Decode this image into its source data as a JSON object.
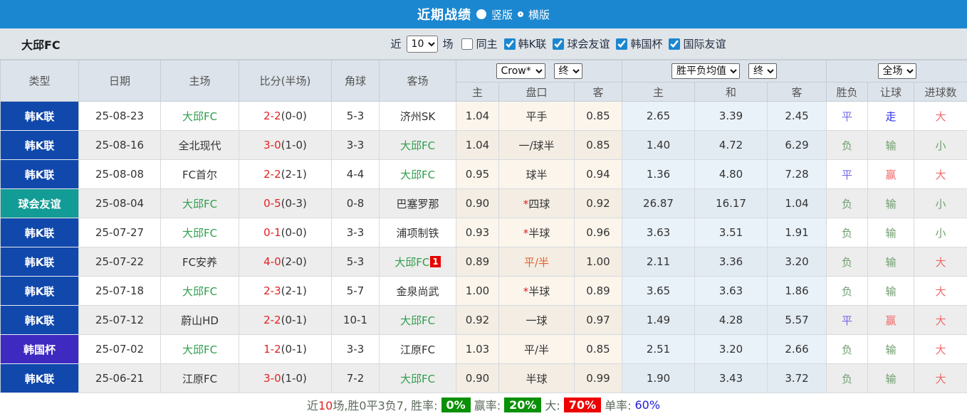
{
  "colors": {
    "topbar": "#1b87d0",
    "league_kleague": "#1148ab",
    "league_friendly": "#129c95",
    "league_cup": "#3e2ac0",
    "team_green": "#2f9e4c",
    "score_red": "#e32020",
    "badge_green": "#0a9006",
    "badge_red": "#ee0000"
  },
  "titlebar": {
    "title": "近期战绩",
    "layout_options": [
      {
        "label": "竖版",
        "selected": true
      },
      {
        "label": "横版",
        "selected": false
      }
    ]
  },
  "filterbar": {
    "team": "大邱FC",
    "near_label": "近",
    "count": "10",
    "games_label": "场",
    "same_home": {
      "label": "同主",
      "checked": false
    },
    "leagues": [
      {
        "label": "韩K联",
        "checked": true
      },
      {
        "label": "球会友谊",
        "checked": true
      },
      {
        "label": "韩国杯",
        "checked": true
      },
      {
        "label": "国际友谊",
        "checked": true
      }
    ]
  },
  "table": {
    "headers_left": [
      "类型",
      "日期",
      "主场",
      "比分(半场)",
      "角球",
      "客场"
    ],
    "dropdowns": {
      "company": "Crow*",
      "company_stage": "终",
      "market": "胜平负均值",
      "market_stage": "终",
      "scope": "全场"
    },
    "subheaders": [
      "主",
      "盘口",
      "客",
      "主",
      "和",
      "客",
      "胜负",
      "让球",
      "进球数"
    ],
    "rows": [
      {
        "type": {
          "text": "韩K联",
          "bg": "#1148ab"
        },
        "date": "25-08-23",
        "home": {
          "text": "大邱FC",
          "color": "team"
        },
        "score": "2-2",
        "half": "(0-0)",
        "corner": "5-3",
        "away": {
          "text": "济州SK",
          "color": "dark",
          "badge": ""
        },
        "ah_home": "1.04",
        "handicap": {
          "star": "",
          "text": "平手",
          "color": "dark"
        },
        "ah_away": "0.85",
        "eu": [
          "2.65",
          "3.39",
          "2.45"
        ],
        "results": [
          {
            "text": "平",
            "color": "violet"
          },
          {
            "text": "走",
            "color": "blue"
          },
          {
            "text": "大",
            "color": "red"
          }
        ]
      },
      {
        "type": {
          "text": "韩K联",
          "bg": "#1148ab"
        },
        "date": "25-08-16",
        "home": {
          "text": "全北现代",
          "color": "dark"
        },
        "score": "3-0",
        "half": "(1-0)",
        "corner": "3-3",
        "away": {
          "text": "大邱FC",
          "color": "team",
          "badge": ""
        },
        "ah_home": "1.04",
        "handicap": {
          "star": "",
          "text": "一/球半",
          "color": "dark"
        },
        "ah_away": "0.85",
        "eu": [
          "1.40",
          "4.72",
          "6.29"
        ],
        "results": [
          {
            "text": "负",
            "color": "green"
          },
          {
            "text": "输",
            "color": "green"
          },
          {
            "text": "小",
            "color": "green"
          }
        ]
      },
      {
        "type": {
          "text": "韩K联",
          "bg": "#1148ab"
        },
        "date": "25-08-08",
        "home": {
          "text": "FC首尔",
          "color": "dark"
        },
        "score": "2-2",
        "half": "(2-1)",
        "corner": "4-4",
        "away": {
          "text": "大邱FC",
          "color": "team",
          "badge": ""
        },
        "ah_home": "0.95",
        "handicap": {
          "star": "",
          "text": "球半",
          "color": "dark"
        },
        "ah_away": "0.94",
        "eu": [
          "1.36",
          "4.80",
          "7.28"
        ],
        "results": [
          {
            "text": "平",
            "color": "violet"
          },
          {
            "text": "赢",
            "color": "red"
          },
          {
            "text": "大",
            "color": "red"
          }
        ]
      },
      {
        "type": {
          "text": "球会友谊",
          "bg": "#129c95"
        },
        "date": "25-08-04",
        "home": {
          "text": "大邱FC",
          "color": "team"
        },
        "score": "0-5",
        "half": "(0-3)",
        "corner": "0-8",
        "away": {
          "text": "巴塞罗那",
          "color": "dark",
          "badge": ""
        },
        "ah_home": "0.90",
        "handicap": {
          "star": "*",
          "text": "四球",
          "color": "dark"
        },
        "ah_away": "0.92",
        "eu": [
          "26.87",
          "16.17",
          "1.04"
        ],
        "results": [
          {
            "text": "负",
            "color": "green"
          },
          {
            "text": "输",
            "color": "green"
          },
          {
            "text": "小",
            "color": "green"
          }
        ]
      },
      {
        "type": {
          "text": "韩K联",
          "bg": "#1148ab"
        },
        "date": "25-07-27",
        "home": {
          "text": "大邱FC",
          "color": "team"
        },
        "score": "0-1",
        "half": "(0-0)",
        "corner": "3-3",
        "away": {
          "text": "浦项制铁",
          "color": "dark",
          "badge": ""
        },
        "ah_home": "0.93",
        "handicap": {
          "star": "*",
          "text": "半球",
          "color": "dark"
        },
        "ah_away": "0.96",
        "eu": [
          "3.63",
          "3.51",
          "1.91"
        ],
        "results": [
          {
            "text": "负",
            "color": "green"
          },
          {
            "text": "输",
            "color": "green"
          },
          {
            "text": "小",
            "color": "green"
          }
        ]
      },
      {
        "type": {
          "text": "韩K联",
          "bg": "#1148ab"
        },
        "date": "25-07-22",
        "home": {
          "text": "FC安养",
          "color": "dark"
        },
        "score": "4-0",
        "half": "(2-0)",
        "corner": "5-3",
        "away": {
          "text": "大邱FC",
          "color": "team",
          "badge": "1"
        },
        "ah_home": "0.89",
        "handicap": {
          "star": "",
          "text": "平/半",
          "color": "orange"
        },
        "ah_away": "1.00",
        "eu": [
          "2.11",
          "3.36",
          "3.20"
        ],
        "results": [
          {
            "text": "负",
            "color": "green"
          },
          {
            "text": "输",
            "color": "green"
          },
          {
            "text": "大",
            "color": "red"
          }
        ]
      },
      {
        "type": {
          "text": "韩K联",
          "bg": "#1148ab"
        },
        "date": "25-07-18",
        "home": {
          "text": "大邱FC",
          "color": "team"
        },
        "score": "2-3",
        "half": "(2-1)",
        "corner": "5-7",
        "away": {
          "text": "金泉尚武",
          "color": "dark",
          "badge": ""
        },
        "ah_home": "1.00",
        "handicap": {
          "star": "*",
          "text": "半球",
          "color": "dark"
        },
        "ah_away": "0.89",
        "eu": [
          "3.65",
          "3.63",
          "1.86"
        ],
        "results": [
          {
            "text": "负",
            "color": "green"
          },
          {
            "text": "输",
            "color": "green"
          },
          {
            "text": "大",
            "color": "red"
          }
        ]
      },
      {
        "type": {
          "text": "韩K联",
          "bg": "#1148ab"
        },
        "date": "25-07-12",
        "home": {
          "text": "蔚山HD",
          "color": "dark"
        },
        "score": "2-2",
        "half": "(0-1)",
        "corner": "10-1",
        "away": {
          "text": "大邱FC",
          "color": "team",
          "badge": ""
        },
        "ah_home": "0.92",
        "handicap": {
          "star": "",
          "text": "一球",
          "color": "dark"
        },
        "ah_away": "0.97",
        "eu": [
          "1.49",
          "4.28",
          "5.57"
        ],
        "results": [
          {
            "text": "平",
            "color": "violet"
          },
          {
            "text": "赢",
            "color": "red"
          },
          {
            "text": "大",
            "color": "red"
          }
        ]
      },
      {
        "type": {
          "text": "韩国杯",
          "bg": "#3e2ac0"
        },
        "date": "25-07-02",
        "home": {
          "text": "大邱FC",
          "color": "team"
        },
        "score": "1-2",
        "half": "(0-1)",
        "corner": "3-3",
        "away": {
          "text": "江原FC",
          "color": "dark",
          "badge": ""
        },
        "ah_home": "1.03",
        "handicap": {
          "star": "",
          "text": "平/半",
          "color": "dark"
        },
        "ah_away": "0.85",
        "eu": [
          "2.51",
          "3.20",
          "2.66"
        ],
        "results": [
          {
            "text": "负",
            "color": "green"
          },
          {
            "text": "输",
            "color": "green"
          },
          {
            "text": "大",
            "color": "red"
          }
        ]
      },
      {
        "type": {
          "text": "韩K联",
          "bg": "#1148ab"
        },
        "date": "25-06-21",
        "home": {
          "text": "江原FC",
          "color": "dark"
        },
        "score": "3-0",
        "half": "(1-0)",
        "corner": "7-2",
        "away": {
          "text": "大邱FC",
          "color": "team",
          "badge": ""
        },
        "ah_home": "0.90",
        "handicap": {
          "star": "",
          "text": "半球",
          "color": "dark"
        },
        "ah_away": "0.99",
        "eu": [
          "1.90",
          "3.43",
          "3.72"
        ],
        "results": [
          {
            "text": "负",
            "color": "green"
          },
          {
            "text": "输",
            "color": "green"
          },
          {
            "text": "大",
            "color": "red"
          }
        ]
      }
    ]
  },
  "footer": {
    "part1": "近",
    "games": "10",
    "part2": "场,胜0平3负7, 胜率:",
    "win_pct": "0%",
    "part3": "赢率:",
    "profit_pct": "20%",
    "part4": "大:",
    "big_pct": "70%",
    "part5": "单率:",
    "single_pct": "60%"
  }
}
